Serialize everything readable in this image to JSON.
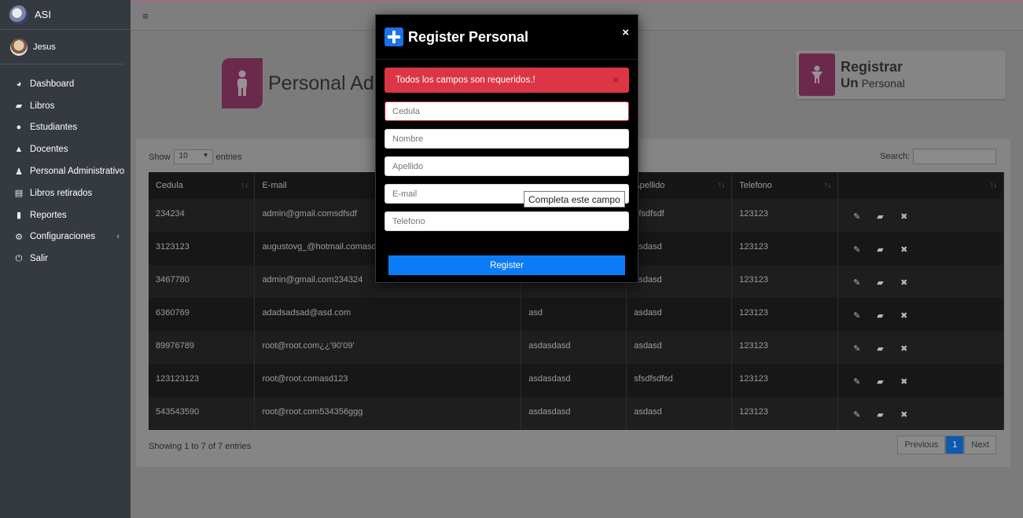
{
  "sidebar": {
    "brand": "ASI",
    "user": "Jesus",
    "items": [
      {
        "label": "Dashboard",
        "icon": "dashboard-icon"
      },
      {
        "label": "Libros",
        "icon": "book-icon"
      },
      {
        "label": "Estudiantes",
        "icon": "users-icon"
      },
      {
        "label": "Docentes",
        "icon": "graduation-cap-icon"
      },
      {
        "label": "Personal Administrativo",
        "icon": "person-icon"
      },
      {
        "label": "Libros retirados",
        "icon": "id-card-icon"
      },
      {
        "label": "Reportes",
        "icon": "file-icon"
      },
      {
        "label": "Configuraciones",
        "icon": "gears-icon"
      },
      {
        "label": "Salir",
        "icon": "power-icon"
      }
    ]
  },
  "header": {
    "title": "Personal Adm",
    "register_line1": "Registrar",
    "register_un": "Un",
    "register_line2": "Personal"
  },
  "table": {
    "show_label": "Show",
    "entries_label": "entries",
    "page_length": "10",
    "search_label": "Search:",
    "columns": [
      "Cedula",
      "E-mail",
      "",
      "Apellido",
      "Telefono",
      ""
    ],
    "rows": [
      [
        "234234",
        "admin@gmail.comsdfsdf",
        "",
        "dfsdfsdf",
        "123123"
      ],
      [
        "3123123",
        "augustovg_@hotmail.comasdasd",
        "asdasdasd",
        "asdasd",
        "123123"
      ],
      [
        "3467780",
        "admin@gmail.com234324",
        "asdasdasd",
        "asdasd",
        "123123"
      ],
      [
        "6360769",
        "adadsadsad@asd.com",
        "asd",
        "asdasd",
        "123123"
      ],
      [
        "89976789",
        "root@root.com¿¿'90'09'",
        "asdasdasd",
        "asdasd",
        "123123"
      ],
      [
        "123123123",
        "root@root.comasd123",
        "asdasdasd",
        "sfsdfsdfsd",
        "123123"
      ],
      [
        "543543590",
        "root@root.com534356ggg",
        "asdasdasd",
        "asdasd",
        "123123"
      ]
    ],
    "info": "Showing 1 to 7 of 7 entries",
    "prev": "Previous",
    "page": "1",
    "next": "Next"
  },
  "modal": {
    "title": "Register Personal",
    "close": "×",
    "alert": "Todos los campos son requeridos.!",
    "alert_close": "×",
    "fields": {
      "cedula": "Cedula",
      "nombre": "Nombre",
      "apellido": "Apellido",
      "email": "E-mail",
      "telefono": "Telefono"
    },
    "tooltip": "Completa este campo",
    "submit": "Register"
  },
  "colors": {
    "accent": "#6b2a4c",
    "primary": "#0b7cf5",
    "danger": "#dc3545",
    "sidebar": "#343a40"
  }
}
